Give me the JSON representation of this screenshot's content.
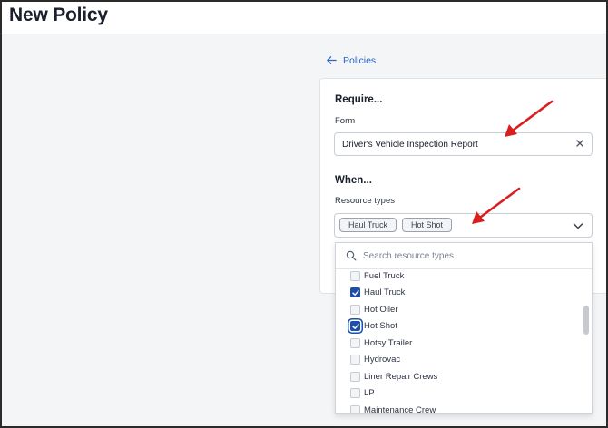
{
  "page": {
    "title": "New Policy"
  },
  "nav": {
    "back_label": "Policies"
  },
  "require": {
    "heading": "Require...",
    "form_label": "Form",
    "form_value": "Driver's Vehicle Inspection Report"
  },
  "when": {
    "heading": "When...",
    "resource_types_label": "Resource types",
    "chips": [
      "Haul Truck",
      "Hot Shot"
    ]
  },
  "dropdown": {
    "search_placeholder": "Search resource types",
    "options": [
      {
        "label": "Fuel Truck",
        "checked": false
      },
      {
        "label": "Haul Truck",
        "checked": true
      },
      {
        "label": "Hot Oiler",
        "checked": false
      },
      {
        "label": "Hot Shot",
        "checked": true
      },
      {
        "label": "Hotsy Trailer",
        "checked": false
      },
      {
        "label": "Hydrovac",
        "checked": false
      },
      {
        "label": "Liner Repair Crews",
        "checked": false
      },
      {
        "label": "LP",
        "checked": false
      },
      {
        "label": "Maintenance Crew",
        "checked": false
      }
    ]
  },
  "colors": {
    "accent": "#1d4fa8",
    "link": "#2b63c4",
    "annotation_arrow": "#d81e1e"
  },
  "icons": [
    "arrow-left-icon",
    "close-icon",
    "chevron-down-icon",
    "search-icon",
    "checkmark-icon"
  ]
}
